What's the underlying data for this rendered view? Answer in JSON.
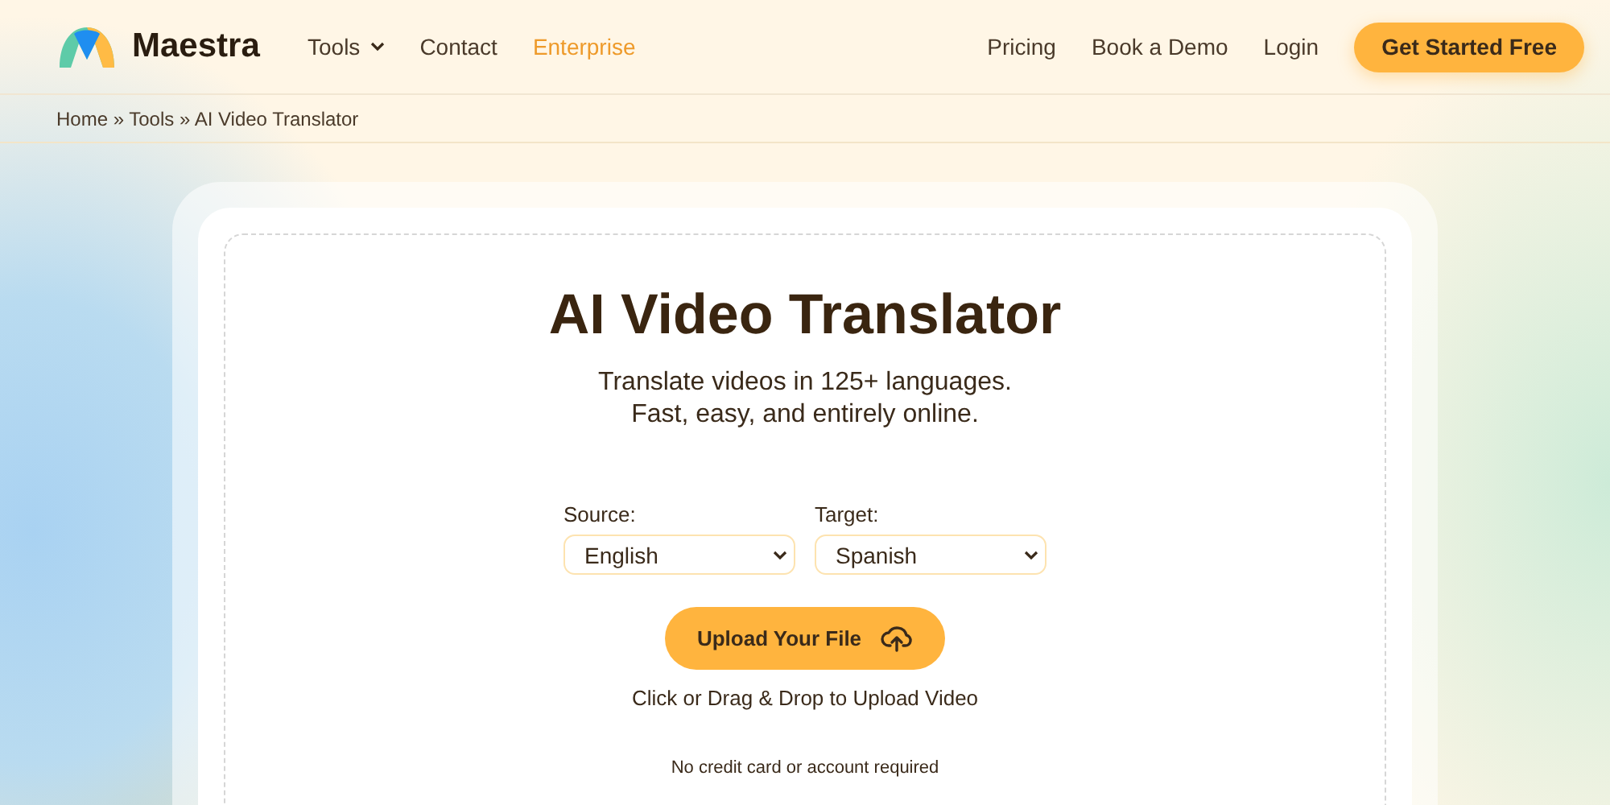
{
  "brand": {
    "name": "Maestra"
  },
  "nav_left": [
    {
      "label": "Tools",
      "dropdown": true,
      "highlighted": false
    },
    {
      "label": "Contact",
      "dropdown": false,
      "highlighted": false
    },
    {
      "label": "Enterprise",
      "dropdown": false,
      "highlighted": true
    }
  ],
  "nav_right": [
    "Pricing",
    "Book a Demo",
    "Login"
  ],
  "cta": "Get Started Free",
  "breadcrumb": "Home » Tools » AI Video Translator",
  "card": {
    "title": "AI Video Translator",
    "subtitle": [
      "Translate videos in 125+ languages.",
      "Fast, easy, and entirely online."
    ],
    "selects": [
      {
        "label": "Source:",
        "value": "English"
      },
      {
        "label": "Target:",
        "value": "Spanish"
      }
    ],
    "upload_button": "Upload Your File",
    "upload_hint": "Click or Drag & Drop to Upload Video",
    "note": "No credit card or account required"
  }
}
